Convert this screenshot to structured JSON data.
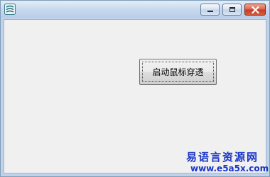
{
  "window": {
    "icon": "app-swirl-icon",
    "controls": {
      "minimize_icon": "minimize-icon",
      "maximize_icon": "maximize-icon",
      "close_icon": "close-icon"
    }
  },
  "main": {
    "button_label": "启动鼠标穿透"
  },
  "watermark": {
    "site_name": "易语言资源网",
    "url": "www.e5a5x.com",
    "color": "#1a35c8"
  }
}
